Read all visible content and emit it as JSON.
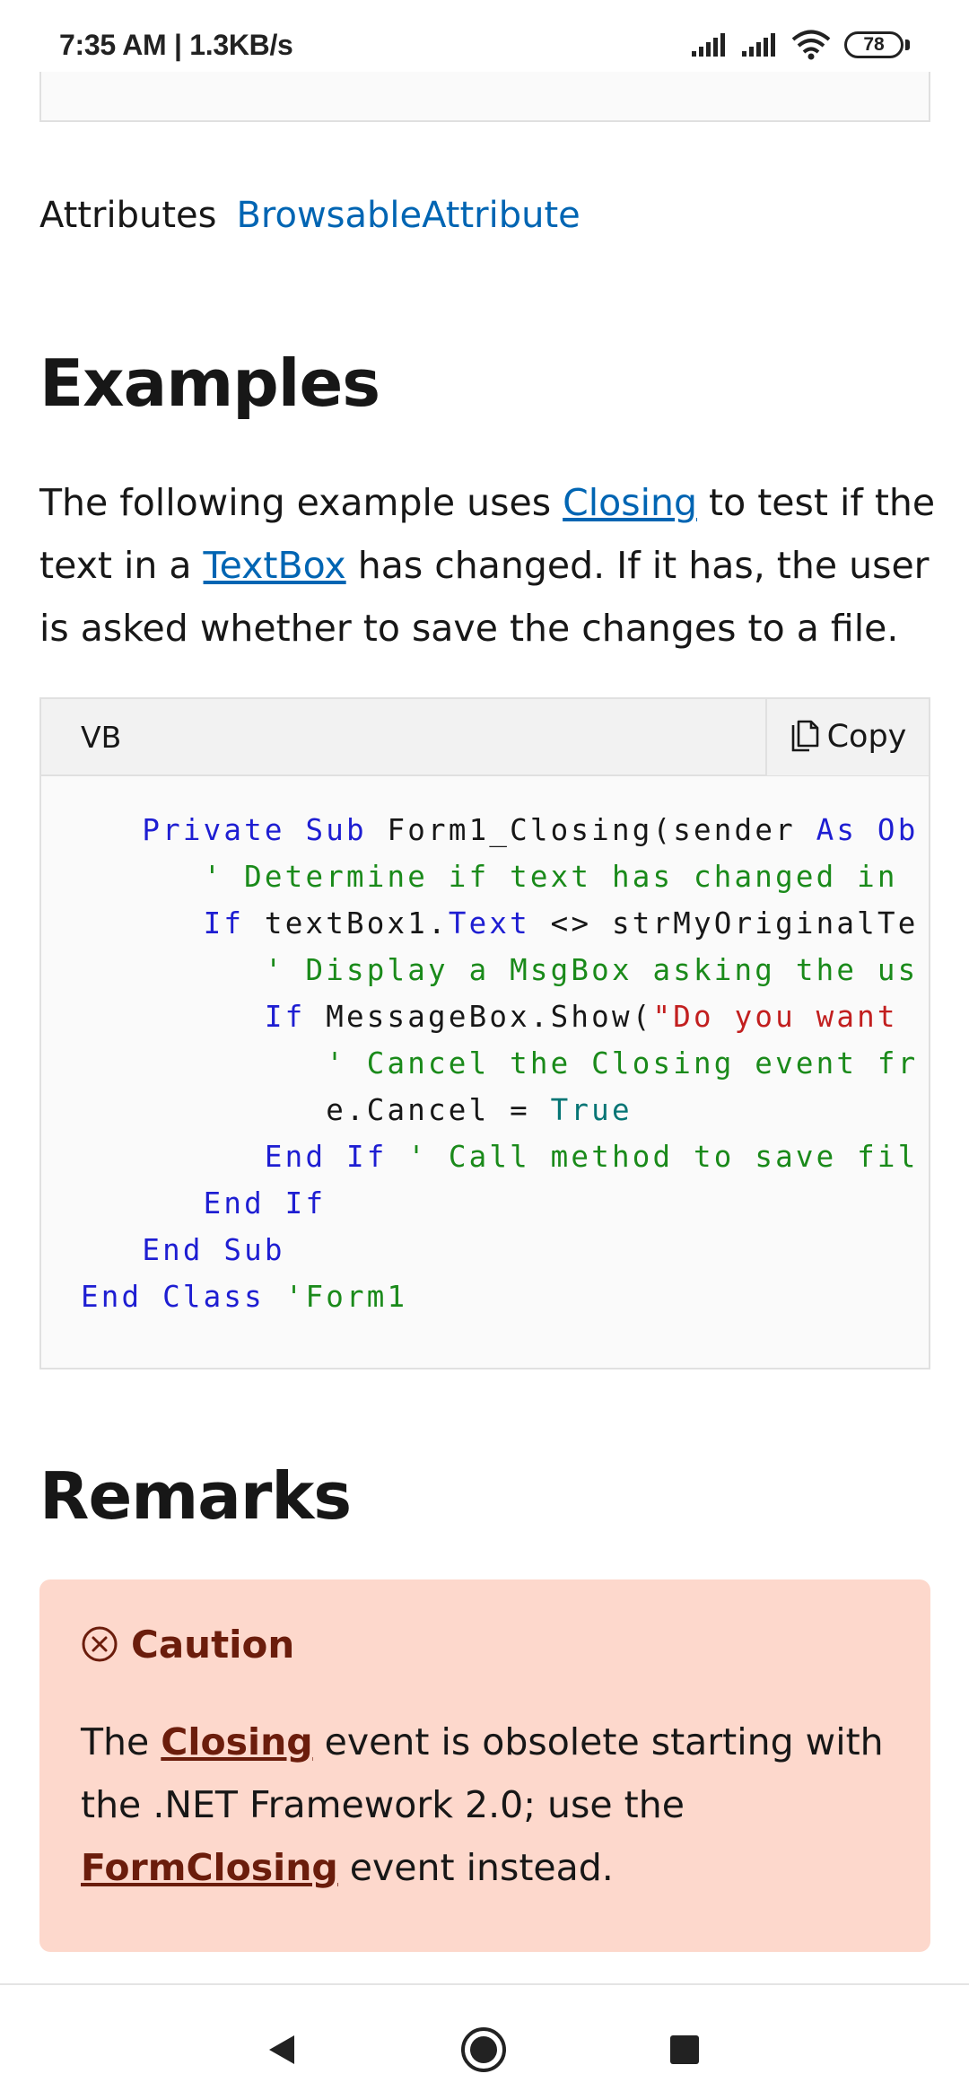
{
  "status_bar": {
    "time_speed": "7:35 AM | 1.3KB/s",
    "battery": "78"
  },
  "attributes": {
    "label": "Attributes",
    "link": "BrowsableAttribute"
  },
  "examples": {
    "heading": "Examples",
    "para_part1": "The following example uses ",
    "link_closing": "Closing",
    "para_part2": " to test if the text in a ",
    "link_textbox": "TextBox",
    "para_part3": " has changed. If it has, the user is asked whether to save the changes to a file."
  },
  "code": {
    "language": "VB",
    "copy_label": "Copy",
    "lines": [
      [
        {
          "t": "   "
        },
        {
          "t": "Private Sub",
          "c": "kw"
        },
        {
          "t": " Form1_Closing(sender "
        },
        {
          "t": "As Ob",
          "c": "kw"
        }
      ],
      [
        {
          "t": "      "
        },
        {
          "t": "' Determine if text has changed in",
          "c": "cm"
        }
      ],
      [
        {
          "t": "      "
        },
        {
          "t": "If",
          "c": "kw"
        },
        {
          "t": " textBox1."
        },
        {
          "t": "Text",
          "c": "kw"
        },
        {
          "t": " <> strMyOriginalTe"
        }
      ],
      [
        {
          "t": "         "
        },
        {
          "t": "' Display a MsgBox asking the us",
          "c": "cm"
        }
      ],
      [
        {
          "t": "         "
        },
        {
          "t": "If",
          "c": "kw"
        },
        {
          "t": " MessageBox.Show("
        },
        {
          "t": "\"Do you want ",
          "c": "st"
        }
      ],
      [
        {
          "t": "            "
        },
        {
          "t": "' Cancel the Closing event fr",
          "c": "cm"
        }
      ],
      [
        {
          "t": "            e.Cancel = "
        },
        {
          "t": "True",
          "c": "vl"
        }
      ],
      [
        {
          "t": "         "
        },
        {
          "t": "End If",
          "c": "kw"
        },
        {
          "t": " "
        },
        {
          "t": "' Call method to save fil",
          "c": "cm"
        }
      ],
      [
        {
          "t": "      "
        },
        {
          "t": "End If",
          "c": "kw"
        }
      ],
      [
        {
          "t": "   "
        },
        {
          "t": "End Sub",
          "c": "kw"
        }
      ],
      [
        {
          "t": "End Class",
          "c": "kw"
        },
        {
          "t": " "
        },
        {
          "t": "'Form1",
          "c": "cm"
        }
      ]
    ]
  },
  "remarks": {
    "heading": "Remarks",
    "caution_title": "Caution",
    "text_part1": "The ",
    "link_closing": "Closing",
    "text_part2": " event is obsolete starting with the .NET Framework 2.0; use the ",
    "link_formclosing": "FormClosing",
    "text_part3": " event instead."
  },
  "colors": {
    "link": "#0065b3",
    "caution_bg": "#fdd8cc",
    "caution_accent": "#6b1d0c"
  },
  "icons": {
    "signal": "signal-icon",
    "wifi": "wifi-icon",
    "copy": "copy-icon",
    "caution": "caution-circle-x-icon",
    "back": "back-triangle-icon",
    "home": "home-circle-icon",
    "recent": "recent-square-icon"
  }
}
